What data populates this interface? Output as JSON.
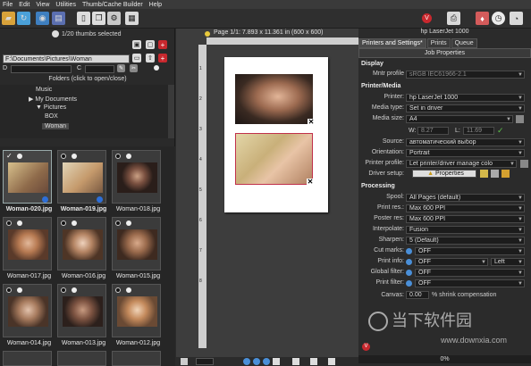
{
  "menu": [
    "File",
    "Edit",
    "View",
    "Utilities",
    "Thumb/Cache Builder",
    "Help"
  ],
  "left": {
    "thumbs_label": "1/20 thumbs selected",
    "path": "F:\\Documents\\Pictures\\Woman",
    "field_d": "D",
    "field_c": "C",
    "folders_title": "Folders (click to open/close)",
    "folders": [
      "Music",
      "My Documents",
      "Pictures",
      "BOX",
      "Woman"
    ],
    "thumbs": [
      {
        "name": "Woman-020.jpg"
      },
      {
        "name": "Woman-019.jpg"
      },
      {
        "name": "Woman-018.jpg"
      },
      {
        "name": "Woman-017.jpg"
      },
      {
        "name": "Woman-016.jpg"
      },
      {
        "name": "Woman-015.jpg"
      },
      {
        "name": "Woman-014.jpg"
      },
      {
        "name": "Woman-013.jpg"
      },
      {
        "name": "Woman-012.jpg"
      }
    ]
  },
  "center": {
    "page_info": "Page 1/1: 7.893 x 11.361 in   (600 x 600)",
    "ruler_numbers": [
      "1",
      "2",
      "3",
      "4",
      "5",
      "6",
      "7",
      "8"
    ],
    "close_glyph": "✕"
  },
  "right": {
    "printer_title": "hp LaserJet 1000",
    "tabs": [
      "Printers and Settings*",
      "Prints",
      "Queue"
    ],
    "job_properties": "Job Properties",
    "display_section": "Display",
    "monitor_profile_label": "Mntr profile",
    "monitor_profile": "sRGB IEC61966-2.1",
    "printer_media_section": "Printer/Media",
    "printer_label": "Printer:",
    "printer": "hp LaserJet 1000",
    "media_type_label": "Media type:",
    "media_type": "Set in driver",
    "media_size_label": "Media size:",
    "media_size": "A4",
    "w_label": "W:",
    "w_value": "8.27",
    "l_label": "L:",
    "l_value": "11.69",
    "source_label": "Source:",
    "source": "автоматический выбор",
    "orientation_label": "Orientation:",
    "orientation": "Portrait",
    "printer_profile_label": "Printer profile:",
    "printer_profile": "Let printer/driver manage colo",
    "driver_setup_label": "Driver setup:",
    "driver_setup": "Properties",
    "processing_section": "Processing",
    "spool_label": "Spool:",
    "spool": "All Pages (default)",
    "print_res_label": "Print res.:",
    "print_res": "Max 600 PPI",
    "poster_res_label": "Poster res:",
    "poster_res": "Max 600 PPI",
    "interpolate_label": "Interpolate:",
    "interpolate": "Fusion",
    "sharpen_label": "Sharpen:",
    "sharpen": "5 (Default)",
    "cut_marks_label": "Cut marks:",
    "cut_marks": "OFF",
    "print_info_label": "Print info:",
    "print_info": "OFF",
    "print_info_pos": "Left",
    "global_filter_label": "Global filter:",
    "global_filter": "OFF",
    "print_filter_label": "Print filter:",
    "print_filter": "OFF",
    "canvas_label": "Canvas:",
    "canvas_value": "0.00",
    "shrink_label": "% shrink compensation",
    "progress": "0%"
  },
  "watermark": {
    "text": "当下软件园",
    "url": "www.downxia.com"
  }
}
